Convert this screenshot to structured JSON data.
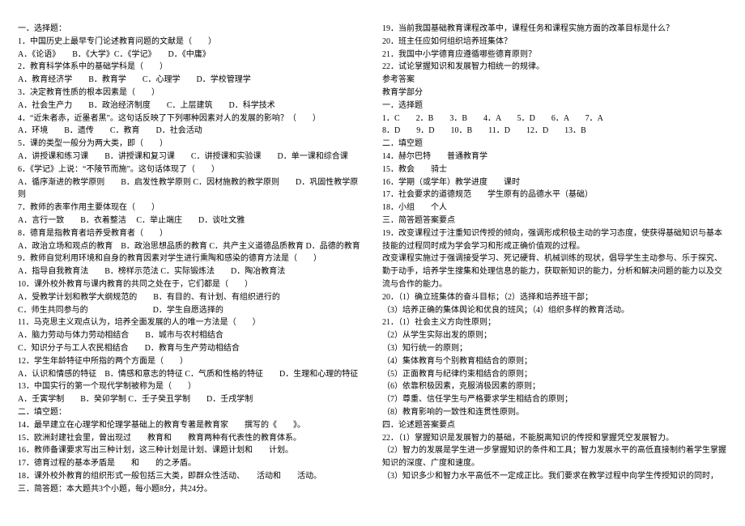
{
  "lines": [
    "一．选择题：",
    "1．中国历史上最早专门论述教育问题的文献是（　　）",
    "A．《论语》　　B．《大学》C．《学记》　　D．《中庸》",
    "2．教育科学体系中的基础学科是（　　）",
    "A．教育经济学　　B．教育学　　C．心理学　　D．学校管理学",
    "3．决定教育性质的根本因素是（　　）",
    "A．社会生产力　　B．政治经济制度　　C．上层建筑　　D．科学技术",
    "4．“近朱者赤，近墨者黑”。这句话反映了下列哪种因素对人的发展的影响？（　　）",
    "A．环境　　B．遗传　　C．教育　　D．社会活动",
    "5．课的类型一般分为两大类，即（　　）",
    "A．讲授课和练习课　　B．讲授课和复习课　　C．讲授课和实验课　　D．单一课和综合课",
    "6．《学记》上说：“不陵节而施”。这句话体现了（　　）",
    "A．循序渐进的教学原则　　B．启发性教学原则 C．因材施教的教学原则　　D．巩固性教学原则",
    "7．教师的表率作用主要体现在（　　）",
    "A．言行一致　　B．衣着整洁　 C．举止端庄　　D．谈吐文雅",
    "8．德育是指教育者培养受教育者（　　）",
    "A．政治立场和观点的教育　B．政治思想品质的教育 C．共产主义道德品质教育 D．品德的教育",
    "9．教师自觉利用环境和自身的教育因素对学生进行熏陶和感染的德育方法是（　　）",
    "A．指导自我教育法　　B．榜样示范法 C．实际锻炼法　　D．陶冶教育法",
    "10．课外校外教育与课内教育的共同之处在于，它们都是（　　）",
    "A．受教学计划和教学大纲规范的　　B．有目的、有计划、有组织进行的",
    "C．师生共同参与的　　　　　　　　D．学生自愿选择的",
    "11．马克思主义观点认为，培养全面发展的人的唯一方法是（　　）",
    "A．脑力劳动与体力劳动相结合　　B．城市与农村相结合",
    "C．知识分子与工人农民相结合　　D．教育与生产劳动相结合",
    "12．学生年龄特征中所指的两个方面是（　　）",
    "A．认识和情感的特征　B．情感和意志的特征 C．气质和性格的特征　　D．生理和心理的特征",
    "13．中国实行的第一个现代学制被称为是（　　）",
    "A．壬寅学制　　B．癸卯学制 C．壬子癸丑学制　　D．壬戌学制",
    "二．填空题：",
    "14．最早建立在心理学和伦理学基础上的教育专著是教育家　　撰写的《　　》。",
    "15．欧洲封建社会里，曾出现过　　教育和　　教育两种有代表性的教育体系。",
    "16．教师备课要求写出三种计划，这三种计划是计划、课题计划和　　计划。",
    "17．德育过程的基本矛盾是　　和　　的之矛盾。",
    "18．课外校外教育的组织形式一般包括三大类，即群众性活动、　　活动和　　活动。",
    "三．简答题：本大题共3个小题，每小题8分，共24分。",
    "19．当前我国基础教育课程改革中，课程任务和课程实施方面的改革目标是什么？",
    "20．班主任应如何组织培养班集体？",
    "21．我国中小学德育应遵循哪些德育原则？",
    "22．试论掌握知识和发展智力相统一的规律。",
    "参考答案",
    "教育学部分",
    "一．选择题",
    "1．C　　2．B　　3．B　　4．A　　5．D　　6．A　　7．A",
    "8．D　　9．D　　10．B　　11．D　　12．D　　13．B",
    "二．填空题",
    "14．赫尔巴特　　普通教育学",
    "15．教会　　骑士",
    "16．学期（或学年）教学进度　　课时",
    "17．社会要求的道德规范　　学生原有的品德水平（基础）",
    "18．小组　　个人",
    "三．简答题答案要点",
    "19．改变课程过于注重知识传授的倾向，强调形成积极主动的学习态度，使获得基础知识与基本技能的过程同时成为学会学习和形成正确价值观的过程。",
    "改变课程实施过于强调接受学习、死记硬背、机械训练的现状，倡导学生主动参与、乐于探究、勤于动手，培养学生搜集和处理信息的能力，获取新知识的能力，分析和解决问题的能力以及交流与合作的能力。",
    "20．（1）确立班集体的奋斗目标；（2）选择和培养班干部；",
    "（3）培养正确的集体舆论和优良的班风；（4）组织多样的教育活动。",
    "21．（1）社会主义方向性原则；",
    "（2）从学生实际出发的原则；",
    "（3）知行统一的原则；",
    "（4）集体教育与个别教育相结合的原则；",
    "（5）正面教育与纪律约束相结合的原则；",
    "（6）依靠积极因素，克服消极因素的原则；",
    "（7）尊重、信任学生与严格要求学生相结合的原则；",
    "（8）教育影响的一致性和连贯性原则。",
    "四．论述题答案要点",
    "22．（1）掌握知识是发展智力的基础，不能脱离知识的传授和掌握凭空发展智力。",
    "（2）智力的发展是学生进一步掌握知识的条件和工具；智力发展水平的高低直接制约着学生掌握知识的深度、广度和速度。",
    "（3）知识多少和智力水平高低不一定成正比。我们要求在教学过程中向学生传授知识的同时，"
  ]
}
